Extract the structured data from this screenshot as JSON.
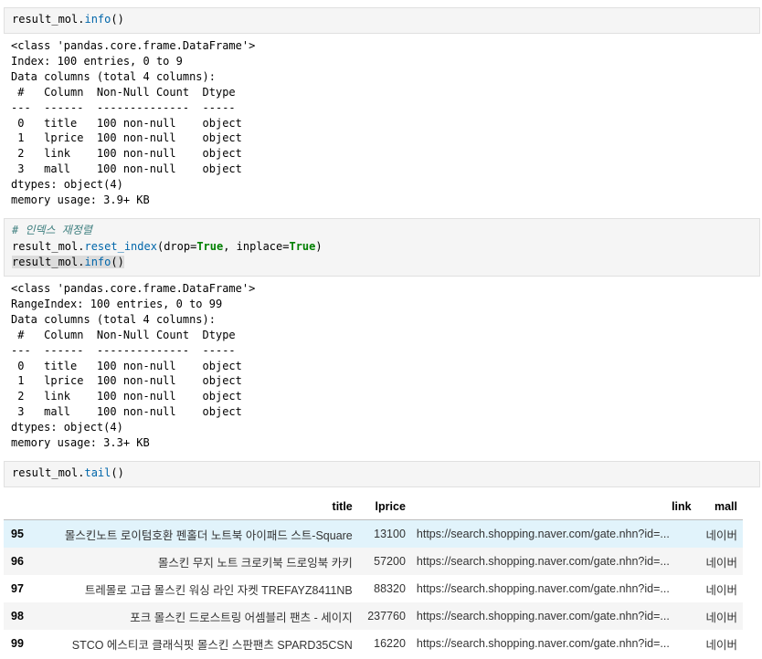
{
  "cell1": {
    "code": {
      "var": "result_mol",
      "dot": ".",
      "fn": "info",
      "paren": "()"
    },
    "output": [
      "<class 'pandas.core.frame.DataFrame'>",
      "Index: 100 entries, 0 to 9",
      "Data columns (total 4 columns):",
      " #   Column  Non-Null Count  Dtype ",
      "---  ------  --------------  ----- ",
      " 0   title   100 non-null    object",
      " 1   lprice  100 non-null    object",
      " 2   link    100 non-null    object",
      " 3   mall    100 non-null    object",
      "dtypes: object(4)",
      "memory usage: 3.9+ KB"
    ]
  },
  "cell2": {
    "comment": "# 인덱스 재정렬",
    "line2": {
      "var": "result_mol",
      "dot": ".",
      "fn": "reset_index",
      "open": "(drop=",
      "kw1": "True",
      "mid": ", inplace=",
      "kw2": "True",
      "close": ")"
    },
    "line3": {
      "var": "result_mol",
      "dot": ".",
      "fn": "info",
      "paren": "()"
    },
    "output": [
      "<class 'pandas.core.frame.DataFrame'>",
      "RangeIndex: 100 entries, 0 to 99",
      "Data columns (total 4 columns):",
      " #   Column  Non-Null Count  Dtype ",
      "---  ------  --------------  ----- ",
      " 0   title   100 non-null    object",
      " 1   lprice  100 non-null    object",
      " 2   link    100 non-null    object",
      " 3   mall    100 non-null    object",
      "dtypes: object(4)",
      "memory usage: 3.3+ KB"
    ]
  },
  "cell3": {
    "code": {
      "var": "result_mol",
      "dot": ".",
      "fn": "tail",
      "paren": "()"
    }
  },
  "table": {
    "columns": [
      "",
      "title",
      "lprice",
      "link",
      "mall"
    ],
    "rows": [
      {
        "idx": "95",
        "title": "몰스킨노트 로이텀호환 펜홀더 노트북 아이패드 스트-Square",
        "lprice": "13100",
        "link": "https://search.shopping.naver.com/gate.nhn?id=...",
        "mall": "네이버"
      },
      {
        "idx": "96",
        "title": "몰스킨 무지 노트 크로키북 드로잉북 카키",
        "lprice": "57200",
        "link": "https://search.shopping.naver.com/gate.nhn?id=...",
        "mall": "네이버"
      },
      {
        "idx": "97",
        "title": "트레몰로 고급 몰스킨 워싱 라인 자켓 TREFAYZ8411NB",
        "lprice": "88320",
        "link": "https://search.shopping.naver.com/gate.nhn?id=...",
        "mall": "네이버"
      },
      {
        "idx": "98",
        "title": "포크 몰스킨 드로스트링 어셈블리 팬츠 - 세이지",
        "lprice": "237760",
        "link": "https://search.shopping.naver.com/gate.nhn?id=...",
        "mall": "네이버"
      },
      {
        "idx": "99",
        "title": "STCO 에스티코 클래식핏 몰스킨 스판팬츠 SPARD35CSN",
        "lprice": "16220",
        "link": "https://search.shopping.naver.com/gate.nhn?id=...",
        "mall": "네이버"
      }
    ]
  }
}
